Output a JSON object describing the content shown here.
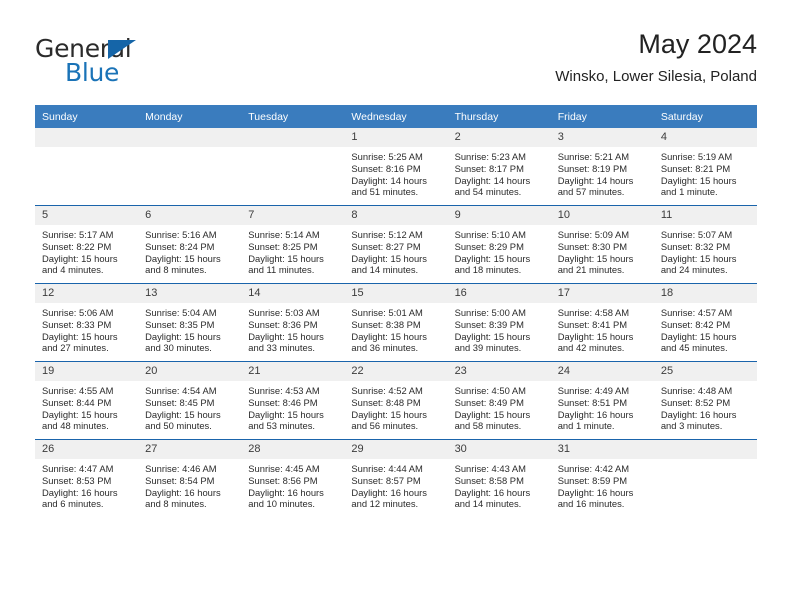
{
  "brand": {
    "name_part1": "General",
    "name_part2": "Blue",
    "flag_icon": "blue-triangle-flag"
  },
  "header": {
    "title": "May 2024",
    "subtitle": "Winsko, Lower Silesia, Poland"
  },
  "colors": {
    "header_band": "#3a7cbe",
    "row_divider": "#1a64ab",
    "daynum_band": "#f0f0f0",
    "brand_blue": "#1a73b7",
    "text": "#2b2b2b"
  },
  "weekdays": [
    "Sunday",
    "Monday",
    "Tuesday",
    "Wednesday",
    "Thursday",
    "Friday",
    "Saturday"
  ],
  "labels": {
    "sunrise": "Sunrise:",
    "sunset": "Sunset:",
    "daylight": "Daylight:"
  },
  "weeks": [
    [
      {
        "day": "",
        "empty": true
      },
      {
        "day": "",
        "empty": true
      },
      {
        "day": "",
        "empty": true
      },
      {
        "day": "1",
        "sunrise": "Sunrise: 5:25 AM",
        "sunset": "Sunset: 8:16 PM",
        "daylight": "Daylight: 14 hours and 51 minutes."
      },
      {
        "day": "2",
        "sunrise": "Sunrise: 5:23 AM",
        "sunset": "Sunset: 8:17 PM",
        "daylight": "Daylight: 14 hours and 54 minutes."
      },
      {
        "day": "3",
        "sunrise": "Sunrise: 5:21 AM",
        "sunset": "Sunset: 8:19 PM",
        "daylight": "Daylight: 14 hours and 57 minutes."
      },
      {
        "day": "4",
        "sunrise": "Sunrise: 5:19 AM",
        "sunset": "Sunset: 8:21 PM",
        "daylight": "Daylight: 15 hours and 1 minute."
      }
    ],
    [
      {
        "day": "5",
        "sunrise": "Sunrise: 5:17 AM",
        "sunset": "Sunset: 8:22 PM",
        "daylight": "Daylight: 15 hours and 4 minutes."
      },
      {
        "day": "6",
        "sunrise": "Sunrise: 5:16 AM",
        "sunset": "Sunset: 8:24 PM",
        "daylight": "Daylight: 15 hours and 8 minutes."
      },
      {
        "day": "7",
        "sunrise": "Sunrise: 5:14 AM",
        "sunset": "Sunset: 8:25 PM",
        "daylight": "Daylight: 15 hours and 11 minutes."
      },
      {
        "day": "8",
        "sunrise": "Sunrise: 5:12 AM",
        "sunset": "Sunset: 8:27 PM",
        "daylight": "Daylight: 15 hours and 14 minutes."
      },
      {
        "day": "9",
        "sunrise": "Sunrise: 5:10 AM",
        "sunset": "Sunset: 8:29 PM",
        "daylight": "Daylight: 15 hours and 18 minutes."
      },
      {
        "day": "10",
        "sunrise": "Sunrise: 5:09 AM",
        "sunset": "Sunset: 8:30 PM",
        "daylight": "Daylight: 15 hours and 21 minutes."
      },
      {
        "day": "11",
        "sunrise": "Sunrise: 5:07 AM",
        "sunset": "Sunset: 8:32 PM",
        "daylight": "Daylight: 15 hours and 24 minutes."
      }
    ],
    [
      {
        "day": "12",
        "sunrise": "Sunrise: 5:06 AM",
        "sunset": "Sunset: 8:33 PM",
        "daylight": "Daylight: 15 hours and 27 minutes."
      },
      {
        "day": "13",
        "sunrise": "Sunrise: 5:04 AM",
        "sunset": "Sunset: 8:35 PM",
        "daylight": "Daylight: 15 hours and 30 minutes."
      },
      {
        "day": "14",
        "sunrise": "Sunrise: 5:03 AM",
        "sunset": "Sunset: 8:36 PM",
        "daylight": "Daylight: 15 hours and 33 minutes."
      },
      {
        "day": "15",
        "sunrise": "Sunrise: 5:01 AM",
        "sunset": "Sunset: 8:38 PM",
        "daylight": "Daylight: 15 hours and 36 minutes."
      },
      {
        "day": "16",
        "sunrise": "Sunrise: 5:00 AM",
        "sunset": "Sunset: 8:39 PM",
        "daylight": "Daylight: 15 hours and 39 minutes."
      },
      {
        "day": "17",
        "sunrise": "Sunrise: 4:58 AM",
        "sunset": "Sunset: 8:41 PM",
        "daylight": "Daylight: 15 hours and 42 minutes."
      },
      {
        "day": "18",
        "sunrise": "Sunrise: 4:57 AM",
        "sunset": "Sunset: 8:42 PM",
        "daylight": "Daylight: 15 hours and 45 minutes."
      }
    ],
    [
      {
        "day": "19",
        "sunrise": "Sunrise: 4:55 AM",
        "sunset": "Sunset: 8:44 PM",
        "daylight": "Daylight: 15 hours and 48 minutes."
      },
      {
        "day": "20",
        "sunrise": "Sunrise: 4:54 AM",
        "sunset": "Sunset: 8:45 PM",
        "daylight": "Daylight: 15 hours and 50 minutes."
      },
      {
        "day": "21",
        "sunrise": "Sunrise: 4:53 AM",
        "sunset": "Sunset: 8:46 PM",
        "daylight": "Daylight: 15 hours and 53 minutes."
      },
      {
        "day": "22",
        "sunrise": "Sunrise: 4:52 AM",
        "sunset": "Sunset: 8:48 PM",
        "daylight": "Daylight: 15 hours and 56 minutes."
      },
      {
        "day": "23",
        "sunrise": "Sunrise: 4:50 AM",
        "sunset": "Sunset: 8:49 PM",
        "daylight": "Daylight: 15 hours and 58 minutes."
      },
      {
        "day": "24",
        "sunrise": "Sunrise: 4:49 AM",
        "sunset": "Sunset: 8:51 PM",
        "daylight": "Daylight: 16 hours and 1 minute."
      },
      {
        "day": "25",
        "sunrise": "Sunrise: 4:48 AM",
        "sunset": "Sunset: 8:52 PM",
        "daylight": "Daylight: 16 hours and 3 minutes."
      }
    ],
    [
      {
        "day": "26",
        "sunrise": "Sunrise: 4:47 AM",
        "sunset": "Sunset: 8:53 PM",
        "daylight": "Daylight: 16 hours and 6 minutes."
      },
      {
        "day": "27",
        "sunrise": "Sunrise: 4:46 AM",
        "sunset": "Sunset: 8:54 PM",
        "daylight": "Daylight: 16 hours and 8 minutes."
      },
      {
        "day": "28",
        "sunrise": "Sunrise: 4:45 AM",
        "sunset": "Sunset: 8:56 PM",
        "daylight": "Daylight: 16 hours and 10 minutes."
      },
      {
        "day": "29",
        "sunrise": "Sunrise: 4:44 AM",
        "sunset": "Sunset: 8:57 PM",
        "daylight": "Daylight: 16 hours and 12 minutes."
      },
      {
        "day": "30",
        "sunrise": "Sunrise: 4:43 AM",
        "sunset": "Sunset: 8:58 PM",
        "daylight": "Daylight: 16 hours and 14 minutes."
      },
      {
        "day": "31",
        "sunrise": "Sunrise: 4:42 AM",
        "sunset": "Sunset: 8:59 PM",
        "daylight": "Daylight: 16 hours and 16 minutes."
      },
      {
        "day": "",
        "empty": true
      }
    ]
  ]
}
